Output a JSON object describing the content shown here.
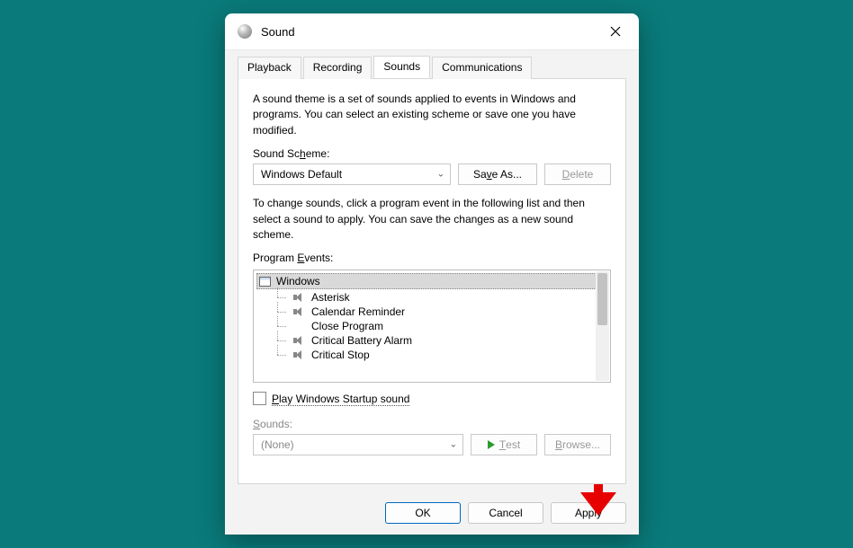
{
  "titlebar": {
    "title": "Sound"
  },
  "tabs": {
    "playback": "Playback",
    "recording": "Recording",
    "sounds": "Sounds",
    "communications": "Communications"
  },
  "pane": {
    "intro": "A sound theme is a set of sounds applied to events in Windows and programs.  You can select an existing scheme or save one you have modified.",
    "scheme_label": "Sound Scheme:",
    "scheme_value": "Windows Default",
    "save_as": "Save As...",
    "delete": "Delete",
    "change_text": "To change sounds, click a program event in the following list and then select a sound to apply.  You can save the changes as a new sound scheme.",
    "events_label": "Program Events:",
    "events_root": "Windows",
    "events": [
      {
        "label": "Asterisk",
        "has_sound": true
      },
      {
        "label": "Calendar Reminder",
        "has_sound": true
      },
      {
        "label": "Close Program",
        "has_sound": false
      },
      {
        "label": "Critical Battery Alarm",
        "has_sound": true
      },
      {
        "label": "Critical Stop",
        "has_sound": true
      }
    ],
    "startup_label": "Play Windows Startup sound",
    "sounds_label": "Sounds:",
    "sounds_value": "(None)",
    "test": "Test",
    "browse": "Browse..."
  },
  "footer": {
    "ok": "OK",
    "cancel": "Cancel",
    "apply": "Apply"
  }
}
